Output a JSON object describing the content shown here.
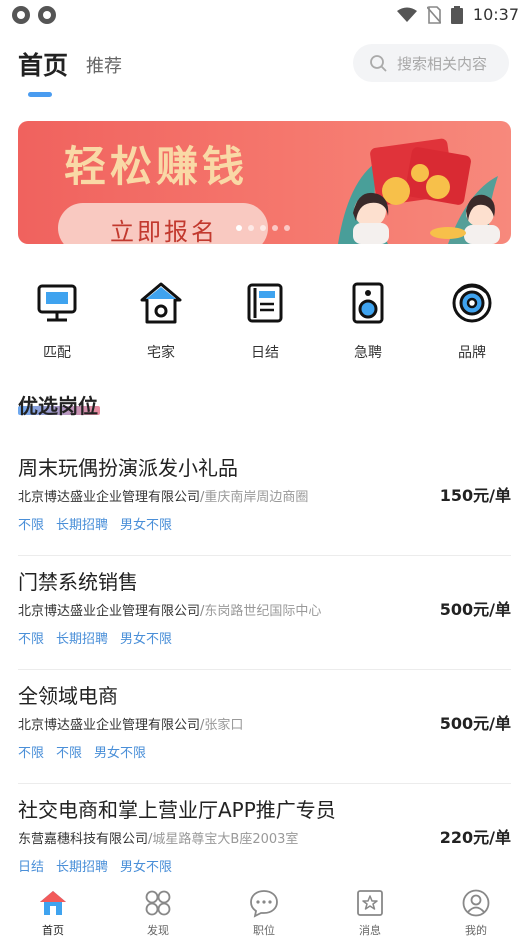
{
  "status": {
    "time": "10:37",
    "icons": [
      "app-icon",
      "app-icon",
      "wifi-icon",
      "no-sim-icon",
      "battery-icon"
    ]
  },
  "header": {
    "tab_home": "首页",
    "tab_recommend": "推荐",
    "search_placeholder": "搜索相关内容"
  },
  "banner": {
    "title": "轻松赚钱",
    "button": "立即报名",
    "dots": 5,
    "active_dot": 0
  },
  "categories": [
    {
      "label": "匹配",
      "icon": "monitor-icon"
    },
    {
      "label": "宅家",
      "icon": "home-icon"
    },
    {
      "label": "日结",
      "icon": "notebook-icon"
    },
    {
      "label": "急聘",
      "icon": "speaker-icon"
    },
    {
      "label": "品牌",
      "icon": "target-icon"
    }
  ],
  "section": {
    "title": "优选岗位"
  },
  "jobs": [
    {
      "title": "周末玩偶扮演派发小礼品",
      "company": "北京博达盛业企业管理有限公司",
      "location": "重庆南岸周边商圈",
      "tags": [
        "不限",
        "长期招聘",
        "男女不限"
      ],
      "price": "150元/单"
    },
    {
      "title": "门禁系统销售",
      "company": "北京博达盛业企业管理有限公司",
      "location": "东岗路世纪国际中心",
      "tags": [
        "不限",
        "长期招聘",
        "男女不限"
      ],
      "price": "500元/单"
    },
    {
      "title": "全领域电商",
      "company": "北京博达盛业企业管理有限公司",
      "location": "张家口",
      "tags": [
        "不限",
        "不限",
        "男女不限"
      ],
      "price": "500元/单"
    },
    {
      "title": "社交电商和掌上营业厅APP推广专员",
      "company": "东营嘉穗科技有限公司",
      "location": "城星路尊宝大B座2003室",
      "tags": [
        "日结",
        "长期招聘",
        "男女不限"
      ],
      "price": "220元/单"
    }
  ],
  "bottom_nav": [
    {
      "label": "首页",
      "icon": "home-icon",
      "active": true
    },
    {
      "label": "发现",
      "icon": "discover-icon",
      "active": false
    },
    {
      "label": "职位",
      "icon": "chat-icon",
      "active": false
    },
    {
      "label": "消息",
      "icon": "message-icon",
      "active": false
    },
    {
      "label": "我的",
      "icon": "profile-icon",
      "active": false
    }
  ],
  "colors": {
    "accent": "#4a9cf0",
    "tag": "#4a8fd8",
    "banner_bg": "#f0625e",
    "banner_title": "#f9d9a6"
  }
}
